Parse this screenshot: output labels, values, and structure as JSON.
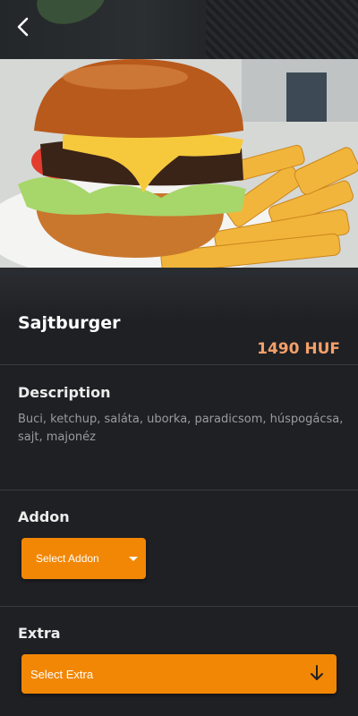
{
  "header": {
    "back_icon": "back-chevron-icon"
  },
  "product": {
    "title": "Sajtburger",
    "price": "1490 HUF",
    "image": "burger-with-fries-photo"
  },
  "description": {
    "label": "Description",
    "text": "Buci, ketchup, saláta, uborka, paradicsom, húspogácsa, sajt, majonéz"
  },
  "addon": {
    "label": "Addon",
    "select_label": "Select Addon",
    "icon": "dropdown-caret-icon"
  },
  "extra": {
    "label": "Extra",
    "select_label": "Select Extra",
    "icon": "arrow-down-icon"
  },
  "colors": {
    "accent": "#f28705",
    "price": "#f3a06a",
    "background": "#1f2024"
  }
}
